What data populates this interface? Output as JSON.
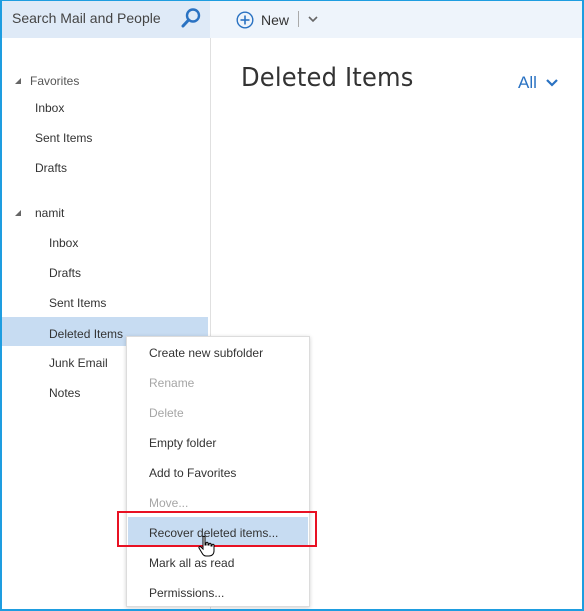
{
  "search": {
    "placeholder": "Search Mail and People",
    "icon": "search-icon"
  },
  "toolbar": {
    "new_label": "New",
    "new_icon": "plus-circle-icon",
    "dropdown_icon": "chevron-down-icon"
  },
  "folders": {
    "favorites": {
      "label": "Favorites",
      "items": [
        {
          "label": "Inbox"
        },
        {
          "label": "Sent Items"
        },
        {
          "label": "Drafts"
        }
      ]
    },
    "account": {
      "label": "namit",
      "items": [
        {
          "label": "Inbox"
        },
        {
          "label": "Drafts"
        },
        {
          "label": "Sent Items"
        },
        {
          "label": "Deleted Items",
          "selected": true
        },
        {
          "label": "Junk Email"
        },
        {
          "label": "Notes"
        }
      ]
    }
  },
  "main": {
    "title": "Deleted Items",
    "filter_label": "All"
  },
  "context_menu": {
    "items": [
      {
        "label": "Create new subfolder",
        "enabled": true
      },
      {
        "label": "Rename",
        "enabled": false
      },
      {
        "label": "Delete",
        "enabled": false
      },
      {
        "label": "Empty folder",
        "enabled": true
      },
      {
        "label": "Add to Favorites",
        "enabled": true
      },
      {
        "label": "Move...",
        "enabled": false
      },
      {
        "label": "Recover deleted items...",
        "enabled": true,
        "hovered": true
      },
      {
        "label": "Mark all as read",
        "enabled": true
      },
      {
        "label": "Permissions...",
        "enabled": true
      }
    ]
  },
  "colors": {
    "accent": "#2a72c2",
    "selection": "#c7dcf2",
    "annotation": "#e81123",
    "frame": "#1e9de0"
  }
}
